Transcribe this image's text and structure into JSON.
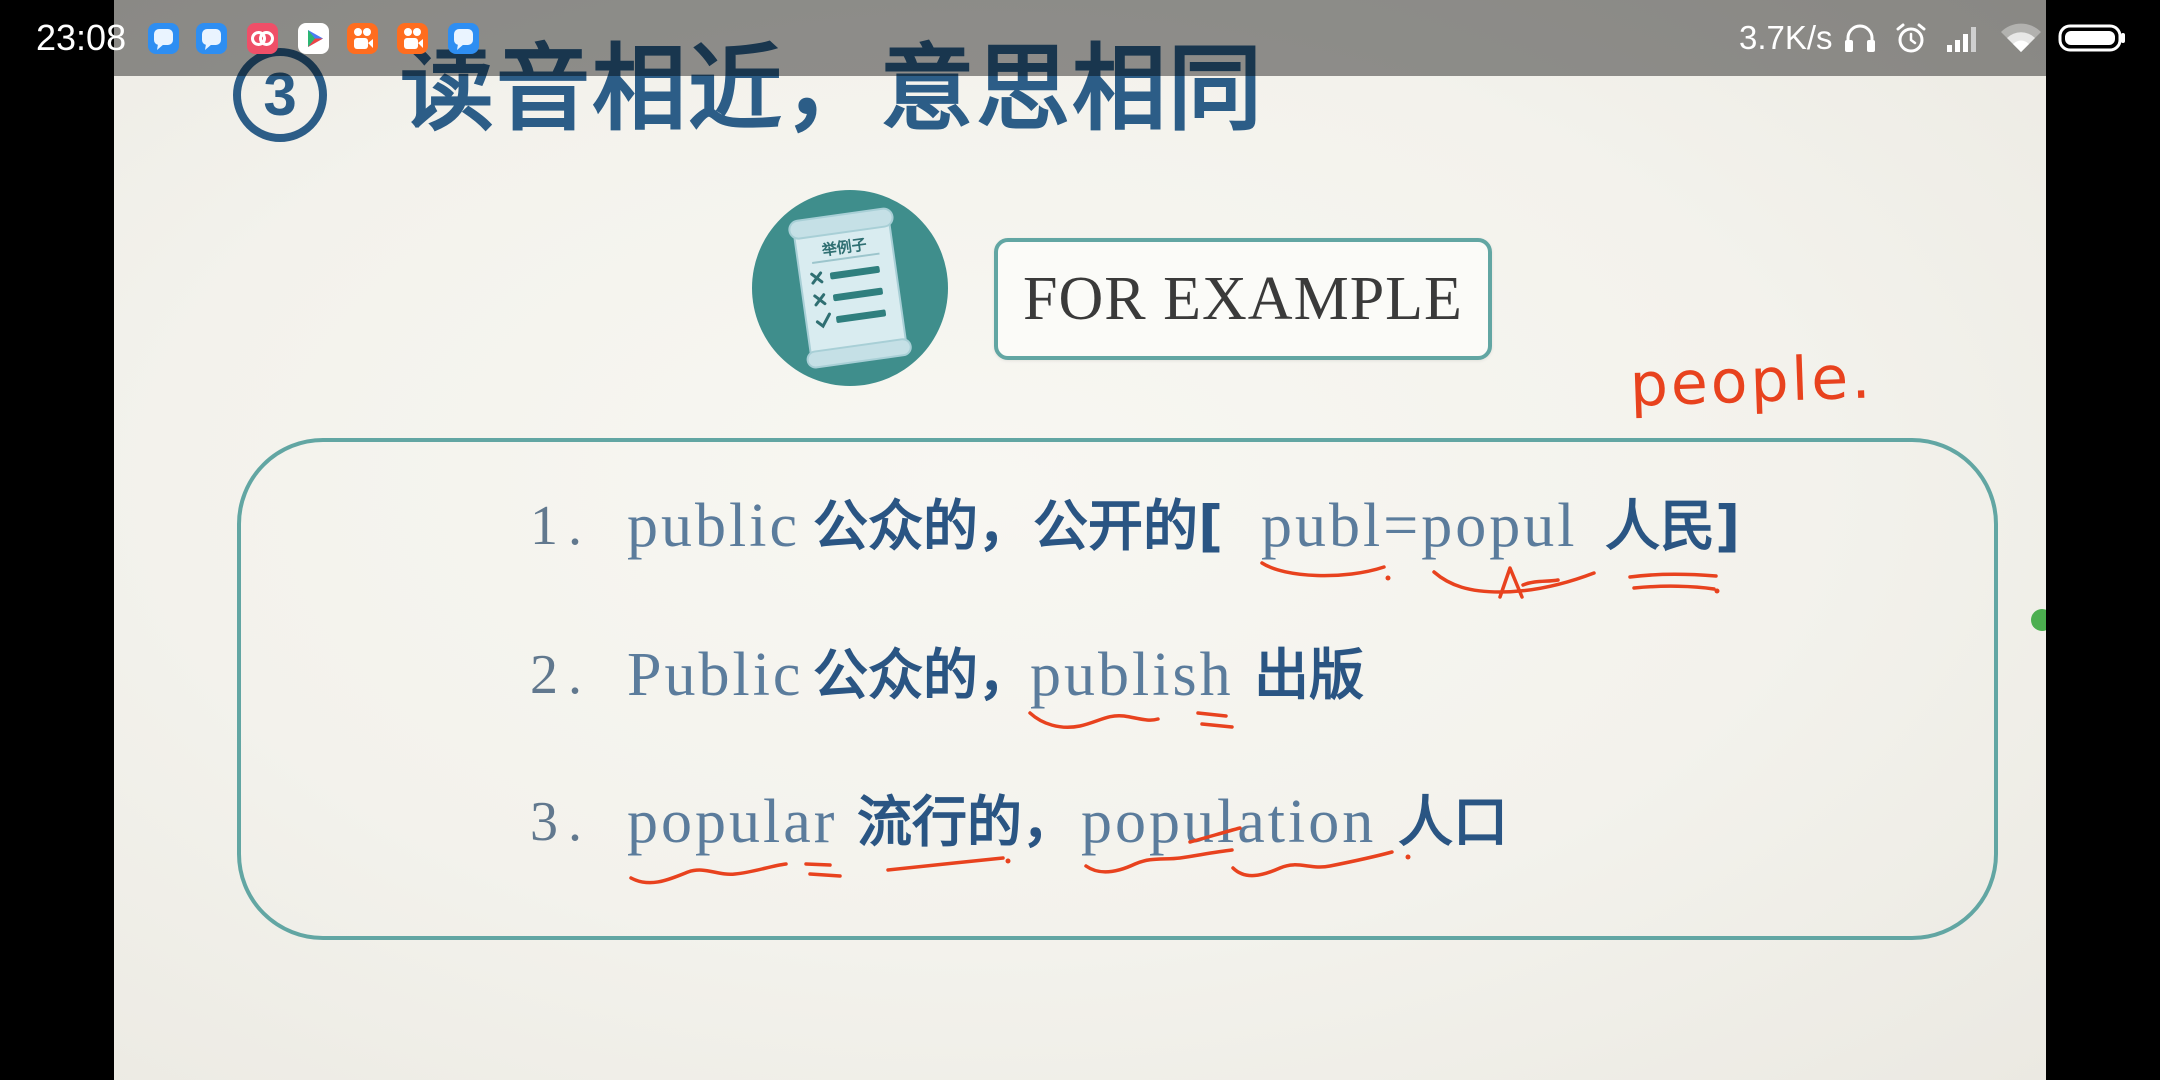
{
  "status_bar": {
    "time": "23:08",
    "network_speed": "3.7K/s",
    "notification_icons": [
      "blue-app-icon",
      "blue-app-icon",
      "pink-app-icon",
      "video-player-icon",
      "orange-app-icon",
      "orange-app-icon",
      "blue-app-icon"
    ],
    "system_icons": [
      "headphone-icon",
      "alarm-clock-icon",
      "signal-strength-icon",
      "wifi-icon",
      "battery-icon"
    ]
  },
  "slide": {
    "title": {
      "number": "3",
      "text": "读音相近，意思相同"
    },
    "example_icon_label": "举例子",
    "example_heading": "FOR EXAMPLE",
    "items": [
      {
        "number": "1.",
        "word": "public",
        "meaning": "公众的，公开的[",
        "related_word": "publ=popul",
        "related_meaning": "人民]"
      },
      {
        "number": "2.",
        "word": "Public",
        "meaning": "公众的，",
        "related_word": "publish",
        "related_meaning": "出版"
      },
      {
        "number": "3.",
        "word": "popular",
        "meaning": "流行的，",
        "related_word": "population",
        "related_meaning": "人口"
      }
    ],
    "handwritten_note": "people."
  },
  "colors": {
    "title_blue": "#2c5d87",
    "accent_teal": "#3f8e8c",
    "box_border_teal": "#62a6a3",
    "ink_red": "#e8421e",
    "slide_background": "#f3f2ec"
  }
}
